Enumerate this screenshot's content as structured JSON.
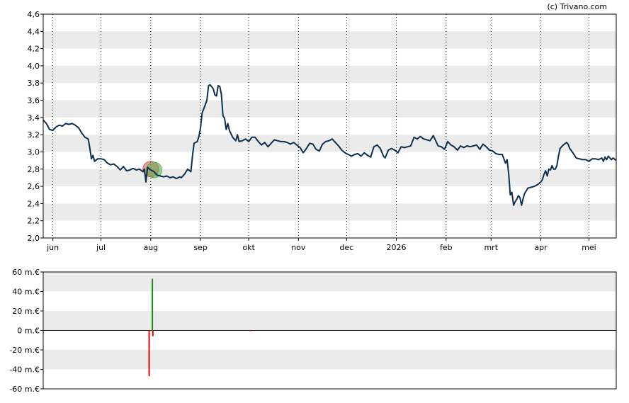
{
  "watermark": "(c) Trivano.com",
  "colors": {
    "line": "#0d3050",
    "band": "#ebebeb",
    "grid": "#000000",
    "volume_positive": "#1a8a1a",
    "volume_negative": "#e8000b",
    "marker_red": "#e05050",
    "marker_green": "#50b050"
  },
  "chart_data": [
    {
      "type": "line",
      "title": "",
      "xlabel": "",
      "ylabel": "",
      "ylim": [
        2.0,
        4.6
      ],
      "yticks": [
        "2,0",
        "2,2",
        "2,4",
        "2,6",
        "2,8",
        "3,0",
        "3,2",
        "3,4",
        "3,6",
        "3,8",
        "4,0",
        "4,2",
        "4,4",
        "4,6"
      ],
      "ytick_values": [
        2.0,
        2.2,
        2.4,
        2.6,
        2.8,
        3.0,
        3.2,
        3.4,
        3.6,
        3.8,
        4.0,
        4.2,
        4.4,
        4.6
      ],
      "xrange_days": [
        0,
        357
      ],
      "month_ticks": [
        {
          "label": "jun",
          "day": 6
        },
        {
          "label": "jul",
          "day": 36
        },
        {
          "label": "aug",
          "day": 67
        },
        {
          "label": "sep",
          "day": 98
        },
        {
          "label": "okt",
          "day": 128
        },
        {
          "label": "nov",
          "day": 159
        },
        {
          "label": "dec",
          "day": 189
        },
        {
          "label": "2026",
          "day": 220
        },
        {
          "label": "feb",
          "day": 251
        },
        {
          "label": "mrt",
          "day": 279
        },
        {
          "label": "apr",
          "day": 310
        },
        {
          "label": "mei",
          "day": 340
        }
      ],
      "grid": true,
      "markers": [
        {
          "day": 67,
          "value": 2.8,
          "kind": "sell"
        },
        {
          "day": 69,
          "value": 2.79,
          "kind": "buy"
        }
      ],
      "series": [
        {
          "name": "",
          "points": [
            [
              0,
              3.37
            ],
            [
              2,
              3.33
            ],
            [
              4,
              3.26
            ],
            [
              6,
              3.25
            ],
            [
              8,
              3.29
            ],
            [
              10,
              3.31
            ],
            [
              12,
              3.3
            ],
            [
              14,
              3.33
            ],
            [
              16,
              3.32
            ],
            [
              18,
              3.33
            ],
            [
              20,
              3.31
            ],
            [
              22,
              3.28
            ],
            [
              24,
              3.22
            ],
            [
              26,
              3.17
            ],
            [
              28,
              3.15
            ],
            [
              29,
              3.05
            ],
            [
              30,
              2.92
            ],
            [
              31,
              2.96
            ],
            [
              32,
              2.89
            ],
            [
              34,
              2.92
            ],
            [
              36,
              2.92
            ],
            [
              38,
              2.91
            ],
            [
              40,
              2.87
            ],
            [
              42,
              2.85
            ],
            [
              44,
              2.86
            ],
            [
              46,
              2.83
            ],
            [
              48,
              2.79
            ],
            [
              50,
              2.83
            ],
            [
              52,
              2.78
            ],
            [
              54,
              2.79
            ],
            [
              56,
              2.81
            ],
            [
              58,
              2.79
            ],
            [
              60,
              2.8
            ],
            [
              62,
              2.77
            ],
            [
              63,
              2.8
            ],
            [
              64,
              2.65
            ],
            [
              65,
              2.82
            ],
            [
              67,
              2.79
            ],
            [
              69,
              2.77
            ],
            [
              71,
              2.73
            ],
            [
              73,
              2.72
            ],
            [
              75,
              2.71
            ],
            [
              77,
              2.72
            ],
            [
              79,
              2.7
            ],
            [
              81,
              2.71
            ],
            [
              83,
              2.69
            ],
            [
              85,
              2.71
            ],
            [
              86,
              2.7
            ],
            [
              88,
              2.74
            ],
            [
              90,
              2.8
            ],
            [
              92,
              2.77
            ],
            [
              93,
              2.95
            ],
            [
              94,
              3.1
            ],
            [
              96,
              3.12
            ],
            [
              97,
              3.18
            ],
            [
              98,
              3.28
            ],
            [
              99,
              3.45
            ],
            [
              101,
              3.55
            ],
            [
              102,
              3.6
            ],
            [
              103,
              3.77
            ],
            [
              104,
              3.78
            ],
            [
              106,
              3.73
            ],
            [
              107,
              3.66
            ],
            [
              108,
              3.65
            ],
            [
              109,
              3.77
            ],
            [
              110,
              3.76
            ],
            [
              111,
              3.67
            ],
            [
              112,
              3.42
            ],
            [
              113,
              3.39
            ],
            [
              114,
              3.26
            ],
            [
              115,
              3.33
            ],
            [
              116,
              3.25
            ],
            [
              118,
              3.17
            ],
            [
              120,
              3.13
            ],
            [
              121,
              3.2
            ],
            [
              122,
              3.12
            ],
            [
              124,
              3.13
            ],
            [
              126,
              3.15
            ],
            [
              128,
              3.12
            ],
            [
              130,
              3.17
            ],
            [
              132,
              3.17
            ],
            [
              134,
              3.12
            ],
            [
              136,
              3.08
            ],
            [
              138,
              3.11
            ],
            [
              140,
              3.06
            ],
            [
              142,
              3.1
            ],
            [
              144,
              3.14
            ],
            [
              146,
              3.13
            ],
            [
              148,
              3.12
            ],
            [
              150,
              3.12
            ],
            [
              152,
              3.11
            ],
            [
              154,
              3.09
            ],
            [
              156,
              3.11
            ],
            [
              158,
              3.08
            ],
            [
              160,
              3.05
            ],
            [
              162,
              2.99
            ],
            [
              164,
              3.04
            ],
            [
              166,
              3.1
            ],
            [
              168,
              3.09
            ],
            [
              170,
              3.03
            ],
            [
              172,
              3.01
            ],
            [
              174,
              3.09
            ],
            [
              176,
              3.12
            ],
            [
              178,
              3.13
            ],
            [
              180,
              3.15
            ],
            [
              182,
              3.11
            ],
            [
              184,
              3.07
            ],
            [
              186,
              3.02
            ],
            [
              188,
              2.99
            ],
            [
              190,
              2.97
            ],
            [
              192,
              2.95
            ],
            [
              194,
              2.97
            ],
            [
              196,
              2.98
            ],
            [
              198,
              2.95
            ],
            [
              200,
              2.99
            ],
            [
              202,
              2.96
            ],
            [
              204,
              2.94
            ],
            [
              206,
              3.06
            ],
            [
              208,
              3.08
            ],
            [
              210,
              3.04
            ],
            [
              212,
              2.95
            ],
            [
              213,
              2.93
            ],
            [
              215,
              3.02
            ],
            [
              217,
              3.04
            ],
            [
              219,
              3.02
            ],
            [
              221,
              2.99
            ],
            [
              223,
              3.06
            ],
            [
              225,
              3.05
            ],
            [
              227,
              3.06
            ],
            [
              229,
              3.07
            ],
            [
              231,
              3.17
            ],
            [
              233,
              3.15
            ],
            [
              235,
              3.18
            ],
            [
              237,
              3.15
            ],
            [
              239,
              3.14
            ],
            [
              241,
              3.13
            ],
            [
              243,
              3.19
            ],
            [
              244,
              3.15
            ],
            [
              246,
              3.07
            ],
            [
              248,
              3.06
            ],
            [
              250,
              3.03
            ],
            [
              252,
              3.12
            ],
            [
              254,
              3.08
            ],
            [
              256,
              3.06
            ],
            [
              258,
              3.02
            ],
            [
              260,
              3.07
            ],
            [
              262,
              3.05
            ],
            [
              264,
              3.07
            ],
            [
              266,
              3.06
            ],
            [
              268,
              3.07
            ],
            [
              270,
              3.08
            ],
            [
              272,
              3.03
            ],
            [
              274,
              3.09
            ],
            [
              276,
              3.06
            ],
            [
              278,
              3.02
            ],
            [
              280,
              3.01
            ],
            [
              282,
              2.98
            ],
            [
              284,
              2.97
            ],
            [
              286,
              2.97
            ],
            [
              288,
              2.87
            ],
            [
              289,
              2.91
            ],
            [
              290,
              2.74
            ],
            [
              291,
              2.5
            ],
            [
              292,
              2.53
            ],
            [
              293,
              2.38
            ],
            [
              294,
              2.42
            ],
            [
              295,
              2.45
            ],
            [
              296,
              2.49
            ],
            [
              297,
              2.47
            ],
            [
              298,
              2.38
            ],
            [
              299,
              2.46
            ],
            [
              300,
              2.52
            ],
            [
              302,
              2.58
            ],
            [
              304,
              2.59
            ],
            [
              306,
              2.6
            ],
            [
              308,
              2.62
            ],
            [
              310,
              2.65
            ],
            [
              311,
              2.68
            ],
            [
              312,
              2.74
            ],
            [
              313,
              2.78
            ],
            [
              314,
              2.72
            ],
            [
              315,
              2.8
            ],
            [
              316,
              2.79
            ],
            [
              317,
              2.84
            ],
            [
              318,
              2.8
            ],
            [
              319,
              2.8
            ],
            [
              320,
              2.84
            ],
            [
              321,
              2.95
            ],
            [
              322,
              3.04
            ],
            [
              324,
              3.08
            ],
            [
              326,
              3.11
            ],
            [
              327,
              3.09
            ],
            [
              328,
              3.04
            ],
            [
              330,
              2.99
            ],
            [
              332,
              2.93
            ],
            [
              334,
              2.92
            ],
            [
              336,
              2.91
            ],
            [
              338,
              2.91
            ],
            [
              340,
              2.89
            ],
            [
              342,
              2.92
            ],
            [
              344,
              2.92
            ],
            [
              346,
              2.91
            ],
            [
              348,
              2.93
            ],
            [
              349,
              2.89
            ],
            [
              350,
              2.94
            ],
            [
              351,
              2.91
            ],
            [
              352,
              2.95
            ],
            [
              354,
              2.91
            ],
            [
              355,
              2.93
            ],
            [
              357,
              2.9
            ]
          ]
        }
      ]
    },
    {
      "type": "bar",
      "title": "",
      "xlabel": "",
      "ylabel": "",
      "ylim": [
        -60,
        60
      ],
      "yticks": [
        "60 m.€",
        "40 m.€",
        "20 m.€",
        "0 m.€",
        "-20 m.€",
        "-40 m.€",
        "-60 m.€"
      ],
      "ytick_values": [
        60,
        40,
        20,
        0,
        -20,
        -40,
        -60
      ],
      "grid": true,
      "bars": [
        {
          "day": 66,
          "value": -47
        },
        {
          "day": 67,
          "value": 0
        },
        {
          "day": 68,
          "value": 53
        },
        {
          "day": 68.3,
          "value": -6
        },
        {
          "day": 129,
          "value": -0.5
        }
      ]
    }
  ]
}
